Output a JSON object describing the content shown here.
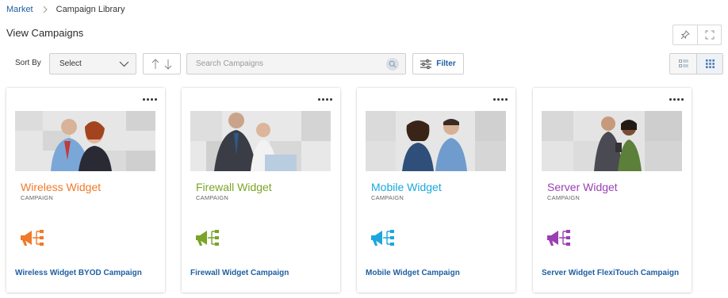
{
  "breadcrumb": {
    "parent": "Market",
    "current": "Campaign Library"
  },
  "page_title": "View Campaigns",
  "toolbar": {
    "sort_label": "Sort By",
    "select_value": "Select",
    "search_placeholder": "Search Campaigns",
    "filter_label": "Filter"
  },
  "icons": {
    "pin": "pin-icon",
    "fullscreen": "fullscreen-icon",
    "list_view": "list-view-icon",
    "grid_view": "grid-view-icon",
    "campaign": "megaphone-network-icon"
  },
  "colors": {
    "link": "#1f5fa3"
  },
  "cards": [
    {
      "title": "Wireless Widget",
      "subtitle": "CAMPAIGN",
      "link": "Wireless Widget BYOD Campaign",
      "color": "#f07a2a"
    },
    {
      "title": "Firewall Widget",
      "subtitle": "CAMPAIGN",
      "link": "Firewall Widget Campaign",
      "color": "#7ba428"
    },
    {
      "title": "Mobile Widget",
      "subtitle": "CAMPAIGN",
      "link": "Mobile Widget Campaign",
      "color": "#1aa7dd"
    },
    {
      "title": "Server Widget",
      "subtitle": "CAMPAIGN",
      "link": "Server Widget FlexiTouch Campaign",
      "color": "#9a3fb3"
    }
  ]
}
